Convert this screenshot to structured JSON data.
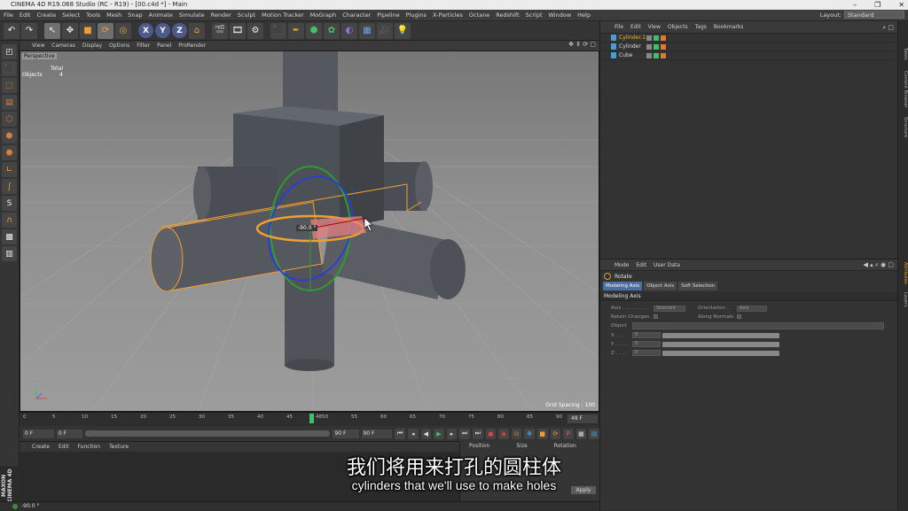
{
  "window": {
    "title": "CINEMA 4D R19.068 Studio (RC - R19) - [00.c4d *] - Main",
    "min": "–",
    "max": "❐",
    "close": "✕"
  },
  "menubar": {
    "items": [
      "File",
      "Edit",
      "Create",
      "Select",
      "Tools",
      "Mesh",
      "Snap",
      "Animate",
      "Simulate",
      "Render",
      "Sculpt",
      "Motion Tracker",
      "MoGraph",
      "Character",
      "Pipeline",
      "Plugins",
      "X-Particles",
      "Octane",
      "Redshift",
      "Script",
      "Window",
      "Help"
    ],
    "layout_label": "Layout:",
    "layout_value": "Standard"
  },
  "viewport": {
    "menu": [
      "View",
      "Cameras",
      "Display",
      "Options",
      "Filter",
      "Panel",
      "ProRender"
    ],
    "camera_label": "Perspective",
    "info": {
      "total_label": "Total",
      "objects_label": "Objects",
      "objects_value": "4"
    },
    "grid_spacing": "Grid Spacing : 100",
    "rotation_readout": "-90.0 °"
  },
  "timeline": {
    "ticks": [
      "0",
      "5",
      "10",
      "15",
      "20",
      "25",
      "30",
      "35",
      "40",
      "45",
      "50",
      "55",
      "60",
      "65",
      "70",
      "75",
      "80",
      "85",
      "90"
    ],
    "current_frame_label": "48",
    "end_frame": "48 F"
  },
  "transport": {
    "start_field": "0 F",
    "left_field": "0 F",
    "right_field": "90 F",
    "end_field": "90 F"
  },
  "material_manager": {
    "menu": [
      "Create",
      "Edit",
      "Function",
      "Texture"
    ]
  },
  "coordinates": {
    "headers": [
      "Position",
      "Size",
      "Rotation"
    ],
    "apply_label": "Apply"
  },
  "status": {
    "text": "-90.0 °"
  },
  "object_manager": {
    "menu": [
      "File",
      "Edit",
      "View",
      "Objects",
      "Tags",
      "Bookmarks"
    ],
    "objects": [
      {
        "name": "Cylinder.1",
        "selected": true
      },
      {
        "name": "Cylinder",
        "selected": false
      },
      {
        "name": "Cube",
        "selected": false
      }
    ]
  },
  "attribute_manager": {
    "menu": [
      "Mode",
      "Edit",
      "User Data"
    ],
    "tool_name": "Rotate",
    "tabs": [
      "Modeling Axis",
      "Object Axis",
      "Soft Selection"
    ],
    "section": "Modeling Axis",
    "axis_label": "Axis . . . . . . . . .",
    "axis_value": "Selected",
    "orientation_label": "Orientation . .",
    "orientation_value": "Axis",
    "retain_label": "Retain Changes",
    "normals_label": "Along Normals",
    "object_label": "Object",
    "x_label": "X . . . .",
    "y_label": "Y . . . .",
    "z_label": "Z . . . .",
    "x_value": "0",
    "y_value": "0",
    "z_value": "0"
  },
  "right_strip": [
    "Takes",
    "Content Browser",
    "Structure",
    "Attributes",
    "Layers"
  ],
  "subtitles": {
    "cn": "我们将用来打孔的圆柱体",
    "en": "cylinders that we'll use to make holes"
  },
  "brand": "MAXON CINEMA 4D"
}
